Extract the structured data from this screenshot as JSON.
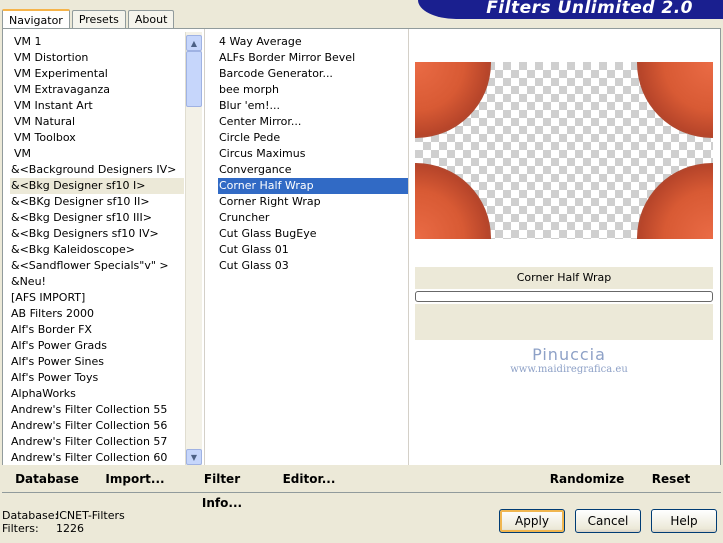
{
  "tabs": [
    {
      "label": "Navigator",
      "active": true
    },
    {
      "label": "Presets",
      "active": false
    },
    {
      "label": "About",
      "active": false
    }
  ],
  "app_title": "Filters Unlimited 2.0",
  "categories": [
    "VM 1",
    "VM Distortion",
    "VM Experimental",
    "VM Extravaganza",
    "VM Instant Art",
    "VM Natural",
    "VM Toolbox",
    "VM",
    "&<Background Designers IV>",
    "&<Bkg Designer sf10 I>",
    "&<BKg Designer sf10 II>",
    "&<Bkg Designer sf10 III>",
    "&<Bkg Designers sf10 IV>",
    "&<Bkg Kaleidoscope>",
    "&<Sandflower Specials\"v\" >",
    "&Neu!",
    "[AFS IMPORT]",
    "AB Filters 2000",
    "Alf's Border FX",
    "Alf's Power Grads",
    "Alf's Power Sines",
    "Alf's Power Toys",
    "AlphaWorks",
    "Andrew's Filter Collection 55",
    "Andrew's Filter Collection 56",
    "Andrew's Filter Collection 57",
    "Andrew's Filter Collection 60"
  ],
  "selected_category_index": 9,
  "filters": [
    "4 Way Average",
    "ALFs Border Mirror Bevel",
    "Barcode Generator...",
    "bee morph",
    "Blur 'em!...",
    "Center Mirror...",
    "Circle Pede",
    "Circus Maximus",
    "Convergance",
    "Corner Half Wrap",
    "Corner Right Wrap",
    "Cruncher",
    "Cut Glass  BugEye",
    "Cut Glass 01",
    "Cut Glass 03"
  ],
  "selected_filter_index": 9,
  "selected_filter_name": "Corner Half Wrap",
  "watermark": {
    "line1": "Pinuccia",
    "line2": "www.maidiregrafica.eu"
  },
  "left_buttons": {
    "database": "Database",
    "import": "Import...",
    "filter_info": "Filter Info...",
    "editor": "Editor..."
  },
  "right_buttons": {
    "randomize": "Randomize",
    "reset": "Reset"
  },
  "status": {
    "database_label": "Database:",
    "database_value": "ICNET-Filters",
    "filters_label": "Filters:",
    "filters_value": "1226"
  },
  "dialog_buttons": {
    "apply": "Apply",
    "cancel": "Cancel",
    "help": "Help"
  },
  "icons": {
    "scroll_up": "▲",
    "scroll_down": "▼"
  },
  "colors": {
    "selection_blue": "#316ac5",
    "brand_blue": "#1a1f8f",
    "tab_accent": "#f6b44a"
  }
}
